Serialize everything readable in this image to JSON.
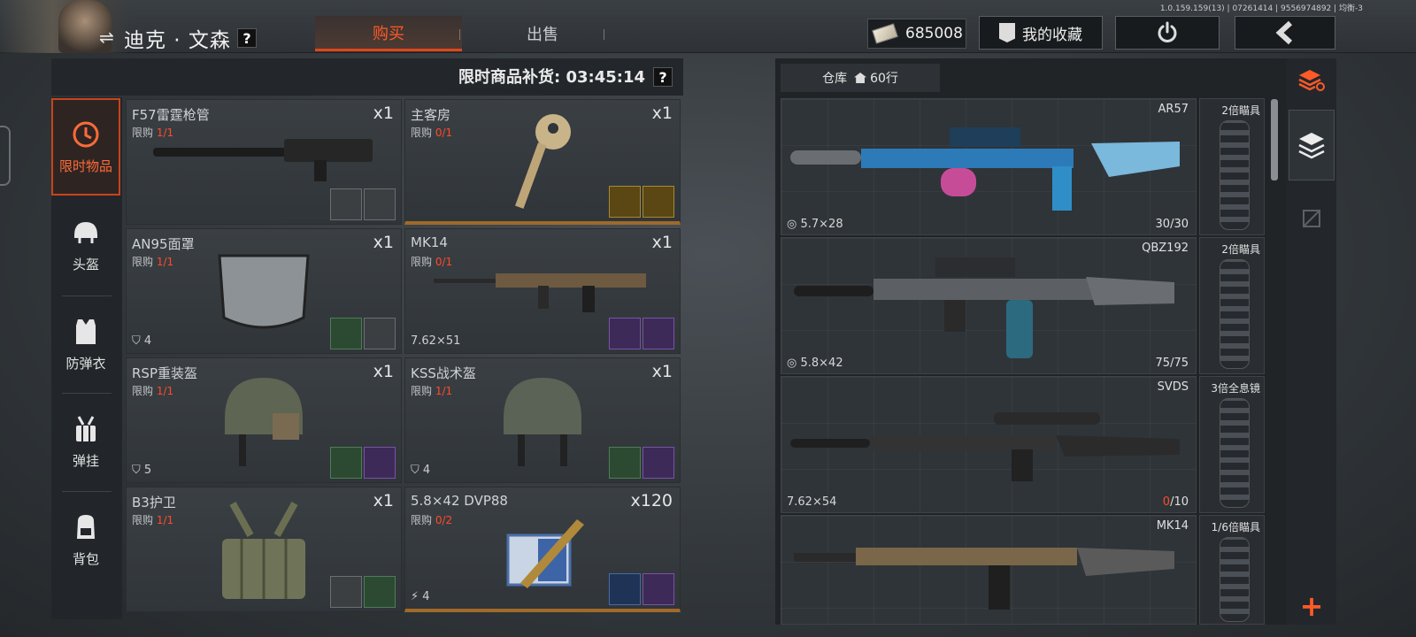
{
  "app": {
    "version": "1.0.159.159(13) | 07261414 | 9556974892 | 均衡-3"
  },
  "player": {
    "name": "迪克 · 文森",
    "help": "?"
  },
  "tabs": {
    "buy": "购买",
    "sell": "出售"
  },
  "currency": {
    "value": "685008",
    "icon": "banknote-icon"
  },
  "header_buttons": {
    "favorites": "我的收藏",
    "power": "power-icon",
    "back": "back-icon"
  },
  "shop": {
    "restock_label": "限时商品补货: 03:45:14",
    "help": "?",
    "limit_label": "限购",
    "categories": [
      {
        "label": "限时物品",
        "icon": "clock-icon"
      },
      {
        "label": "头盔",
        "icon": "helmet-icon"
      },
      {
        "label": "防弹衣",
        "icon": "vest-icon"
      },
      {
        "label": "弹挂",
        "icon": "chest-rig-icon"
      },
      {
        "label": "背包",
        "icon": "backpack-icon"
      }
    ],
    "items": [
      {
        "name": "F57雷霆枪管",
        "limit": "1/1",
        "qty": "x1",
        "stat": ""
      },
      {
        "name": "主客房",
        "limit": "0/1",
        "qty": "x1",
        "stat": ""
      },
      {
        "name": "AN95面罩",
        "limit": "1/1",
        "qty": "x1",
        "stat": "4"
      },
      {
        "name": "MK14",
        "limit": "0/1",
        "qty": "x1",
        "stat": "7.62×51"
      },
      {
        "name": "RSP重装盔",
        "limit": "1/1",
        "qty": "x1",
        "stat": "5"
      },
      {
        "name": "KSS战术盔",
        "limit": "1/1",
        "qty": "x1",
        "stat": "4"
      },
      {
        "name": "B3护卫",
        "limit": "1/1",
        "qty": "x1",
        "stat": ""
      },
      {
        "name": "5.8×42 DVP88",
        "limit": "0/2",
        "qty": "x120",
        "stat": "4"
      }
    ]
  },
  "warehouse": {
    "tab_label": "仓库",
    "capacity": "60行",
    "rows": [
      {
        "name": "AR57",
        "ammo": "5.7×28",
        "count": "30/30",
        "count_current": "",
        "count_total": "",
        "scope": "2倍瞄具"
      },
      {
        "name": "QBZ192",
        "ammo": "5.8×42",
        "count": "75/75",
        "count_current": "",
        "count_total": "",
        "scope": "2倍瞄具"
      },
      {
        "name": "SVDS",
        "ammo": "7.62×54",
        "count": "",
        "count_current": "0",
        "count_total": "/10",
        "scope": "3倍全息镜"
      },
      {
        "name": "MK14",
        "ammo": "",
        "count": "",
        "count_current": "",
        "count_total": "",
        "scope": "1/6倍瞄具"
      }
    ]
  },
  "tools": {
    "add": "+"
  },
  "colors": {
    "accent": "#ff5a28",
    "limit_red": "#ff4a2a"
  }
}
